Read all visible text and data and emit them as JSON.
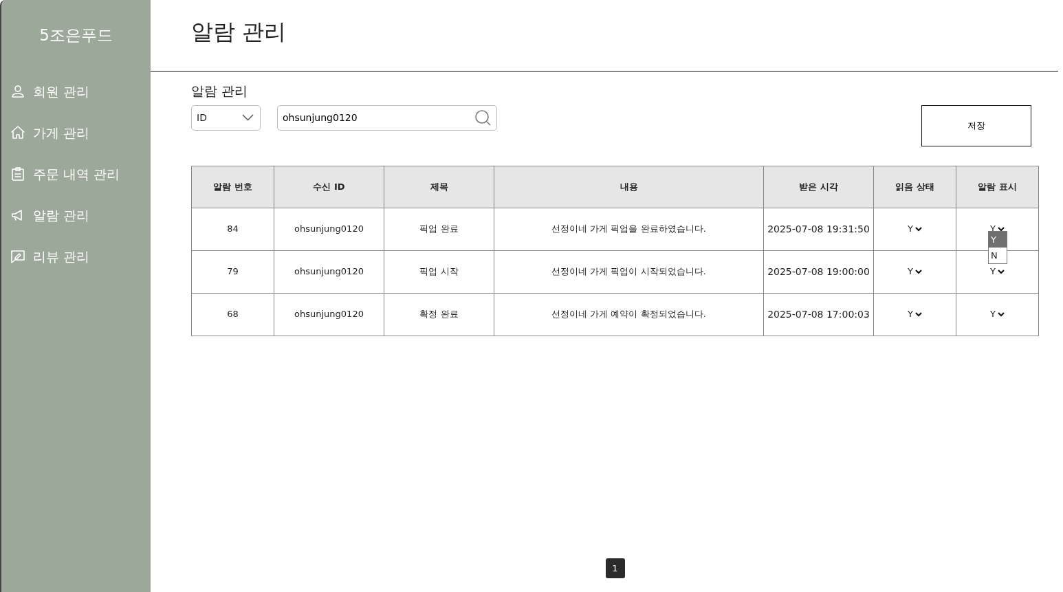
{
  "sidebar": {
    "logo": "5조은푸드",
    "items": [
      {
        "label": "회원 관리",
        "kind": "person"
      },
      {
        "label": "가게 관리",
        "kind": "house"
      },
      {
        "label": "주문 내역 관리",
        "kind": "clipboard"
      },
      {
        "label": "알람 관리",
        "kind": "megaphone"
      },
      {
        "label": "리뷰 관리",
        "kind": "review"
      }
    ]
  },
  "page_title": "알람 관리",
  "section_title": "알람 관리",
  "filter": {
    "select_value": "ID",
    "search_value": "ohsunjung0120"
  },
  "save_button": "저장",
  "table": {
    "columns": [
      "알람 번호",
      "수신 ID",
      "제목",
      "내용",
      "받은 시각",
      "읽음 상태",
      "알람 표시"
    ],
    "rows": [
      {
        "number": "84",
        "receiver": "ohsunjung0120",
        "title": "픽업 완료",
        "content": "선정이네 가게 픽업을 완료하였습니다.",
        "time": "2025-07-08 19:31:50",
        "read": "Y",
        "alarm": {
          "value": "Y",
          "open": true,
          "options": [
            {
              "label": "Y",
              "selected": true
            },
            {
              "label": "N",
              "selected": false
            }
          ]
        }
      },
      {
        "number": "79",
        "receiver": "ohsunjung0120",
        "title": "픽업 시작",
        "content": "선정이네 가게 픽업이 시작되었습니다.",
        "time": "2025-07-08 19:00:00",
        "read": "Y",
        "alarm": {
          "value": "Y",
          "open": false
        }
      },
      {
        "number": "68",
        "receiver": "ohsunjung0120",
        "title": "확정 완료",
        "content": "선정이네 가게 예약이 확정되었습니다.",
        "time": "2025-07-08 17:00:03",
        "read": "Y",
        "alarm": {
          "value": "Y",
          "open": false
        }
      }
    ]
  },
  "pagination": [
    {
      "label": "1",
      "selected": true
    }
  ]
}
